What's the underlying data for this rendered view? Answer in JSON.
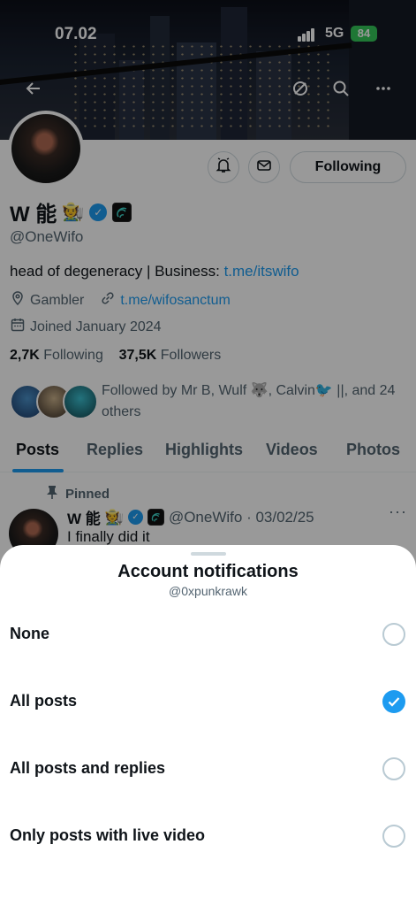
{
  "status_bar": {
    "time": "07.02",
    "network": "5G",
    "battery": "84"
  },
  "profile": {
    "name": "W 能",
    "name_emoji": "🧑‍🌾",
    "handle": "@OneWifo",
    "bio_text": "head of degeneracy | Business: ",
    "bio_link": "t.me/itswifo",
    "location": "Gambler",
    "website": "t.me/wifosanctum",
    "joined": "Joined January 2024",
    "following_count": "2,7K",
    "following_label": "Following",
    "followers_count": "37,5K",
    "followers_label": "Followers",
    "followed_by": "Followed by Mr B, Wulf 🐺, Calvin🐦 ||, and 24 others",
    "following_button": "Following"
  },
  "tabs": [
    "Posts",
    "Replies",
    "Highlights",
    "Videos",
    "Photos"
  ],
  "pinned_post": {
    "pinned_label": "Pinned",
    "name": "W 能",
    "handle_date": "@OneWifo · 03/02/25",
    "text": "I finally did it"
  },
  "sheet": {
    "title": "Account notifications",
    "subtitle": "@0xpunkrawk",
    "options": [
      {
        "label": "None",
        "selected": false
      },
      {
        "label": "All posts",
        "selected": true
      },
      {
        "label": "All posts and replies",
        "selected": false
      },
      {
        "label": "Only posts with live video",
        "selected": false
      }
    ]
  },
  "colors": {
    "accent": "#1d9bf0",
    "battery": "#34c759",
    "muted": "#536471"
  },
  "icons": [
    "back-arrow-icon",
    "mute-icon",
    "search-icon",
    "more-icon",
    "notification-bell-icon",
    "message-icon",
    "verified-badge-icon",
    "affiliate-badge-icon",
    "location-icon",
    "link-icon",
    "calendar-icon",
    "pin-icon",
    "checkmark-icon"
  ]
}
